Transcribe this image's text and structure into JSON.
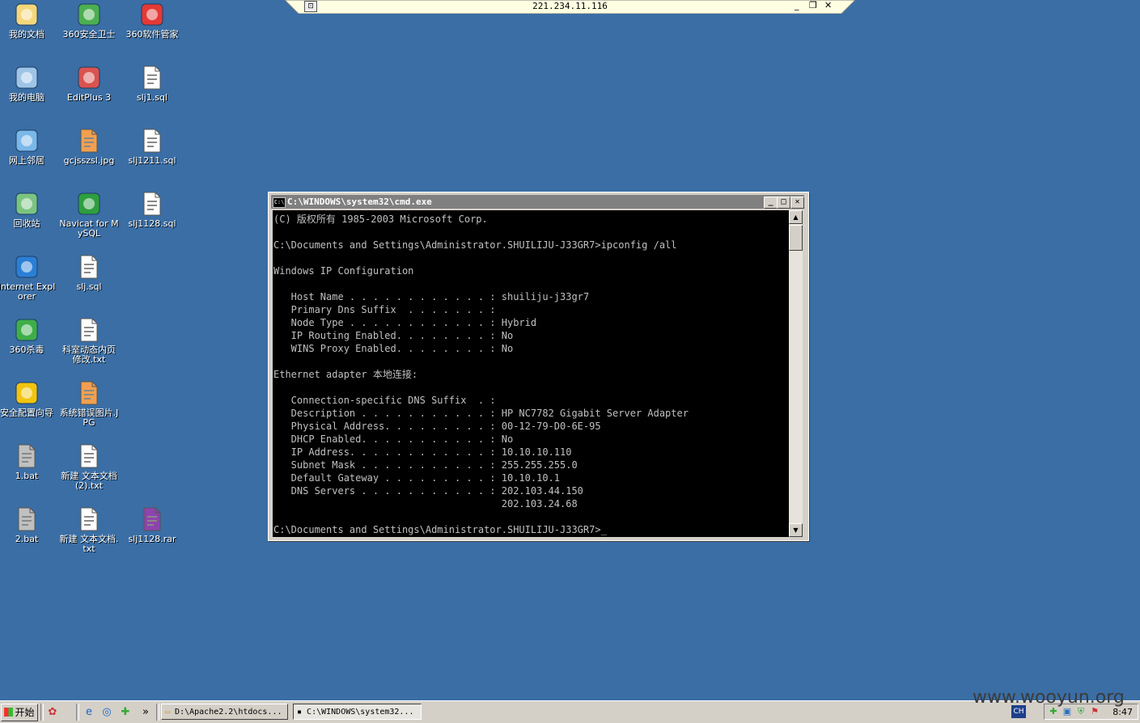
{
  "desktop": {
    "icons": [
      {
        "label": "我的文档",
        "icon": "my-documents-icon",
        "color": "#f4d77a"
      },
      {
        "label": "360安全卫士",
        "icon": "360-safe-icon",
        "color": "#4caf50"
      },
      {
        "label": "360软件管家",
        "icon": "360-software-icon",
        "color": "#e53935"
      },
      {
        "label": "我的电脑",
        "icon": "my-computer-icon",
        "color": "#9ec5e8"
      },
      {
        "label": "EditPlus 3",
        "icon": "editplus-icon",
        "color": "#d9534f"
      },
      {
        "label": "slj1.sql",
        "icon": "sql-file-icon",
        "color": "#ffffff"
      },
      {
        "label": "网上邻居",
        "icon": "network-places-icon",
        "color": "#7ab8e8"
      },
      {
        "label": "gcjsszsl.jpg",
        "icon": "jpg-file-icon",
        "color": "#f0a050"
      },
      {
        "label": "slj1211.sql",
        "icon": "sql-file-icon",
        "color": "#ffffff"
      },
      {
        "label": "回收站",
        "icon": "recycle-bin-icon",
        "color": "#7bc47f"
      },
      {
        "label": "Navicat for MySQL",
        "icon": "navicat-icon",
        "color": "#2e9e3e"
      },
      {
        "label": "slj1128.sql",
        "icon": "sql-file-icon",
        "color": "#ffffff"
      },
      {
        "label": "Internet Explorer",
        "icon": "internet-explorer-icon",
        "color": "#2a7fd4"
      },
      {
        "label": "slj.sql",
        "icon": "sql-file-icon",
        "color": "#ffffff"
      },
      {
        "label": "360杀毒",
        "icon": "360-antivirus-icon",
        "color": "#3fae49"
      },
      {
        "label": "科室动态内页修改.txt",
        "icon": "txt-file-icon",
        "color": "#ffffff"
      },
      {
        "label": "安全配置向导",
        "icon": "security-wizard-icon",
        "color": "#f1c40f"
      },
      {
        "label": "系统错误图片.JPG",
        "icon": "jpg-file-icon",
        "color": "#f0a050"
      },
      {
        "label": "1.bat",
        "icon": "bat-file-icon",
        "color": "#c0c0c0"
      },
      {
        "label": "新建 文本文档 (2).txt",
        "icon": "txt-file-icon",
        "color": "#ffffff"
      },
      {
        "label": "2.bat",
        "icon": "bat-file-icon",
        "color": "#c0c0c0"
      },
      {
        "label": "新建 文本文档.txt",
        "icon": "txt-file-icon",
        "color": "#ffffff"
      },
      {
        "label": "slj1128.rar",
        "icon": "rar-archive-icon",
        "color": "#8e44ad"
      }
    ]
  },
  "rdp": {
    "address": "221.234.11.116",
    "minimize": "_",
    "restore": "❐",
    "close": "✕"
  },
  "cmd_window": {
    "title": "C:\\WINDOWS\\system32\\cmd.exe",
    "minimize": "_",
    "maximize": "□",
    "close": "✕",
    "lines": [
      "(C) 版权所有 1985-2003 Microsoft Corp.",
      "",
      "C:\\Documents and Settings\\Administrator.SHUILIJU-J33GR7>ipconfig /all",
      "",
      "Windows IP Configuration",
      "",
      "   Host Name . . . . . . . . . . . . : shuiliju-j33gr7",
      "   Primary Dns Suffix  . . . . . . . :",
      "   Node Type . . . . . . . . . . . . : Hybrid",
      "   IP Routing Enabled. . . . . . . . : No",
      "   WINS Proxy Enabled. . . . . . . . : No",
      "",
      "Ethernet adapter 本地连接:",
      "",
      "   Connection-specific DNS Suffix  . :",
      "   Description . . . . . . . . . . . : HP NC7782 Gigabit Server Adapter",
      "   Physical Address. . . . . . . . . : 00-12-79-D0-6E-95",
      "   DHCP Enabled. . . . . . . . . . . : No",
      "   IP Address. . . . . . . . . . . . : 10.10.10.110",
      "   Subnet Mask . . . . . . . . . . . : 255.255.255.0",
      "   Default Gateway . . . . . . . . . : 10.10.10.1",
      "   DNS Servers . . . . . . . . . . . : 202.103.44.150",
      "                                       202.103.24.68",
      "",
      "C:\\Documents and Settings\\Administrator.SHUILIJU-J33GR7>_"
    ]
  },
  "taskbar": {
    "start_label": "开始",
    "more": "»",
    "tasks": [
      {
        "label": "D:\\Apache2.2\\htdocs..."
      },
      {
        "label": "C:\\WINDOWS\\system32..."
      }
    ],
    "language": "CH",
    "clock": "8:47"
  },
  "watermark": "www.wooyun.org"
}
